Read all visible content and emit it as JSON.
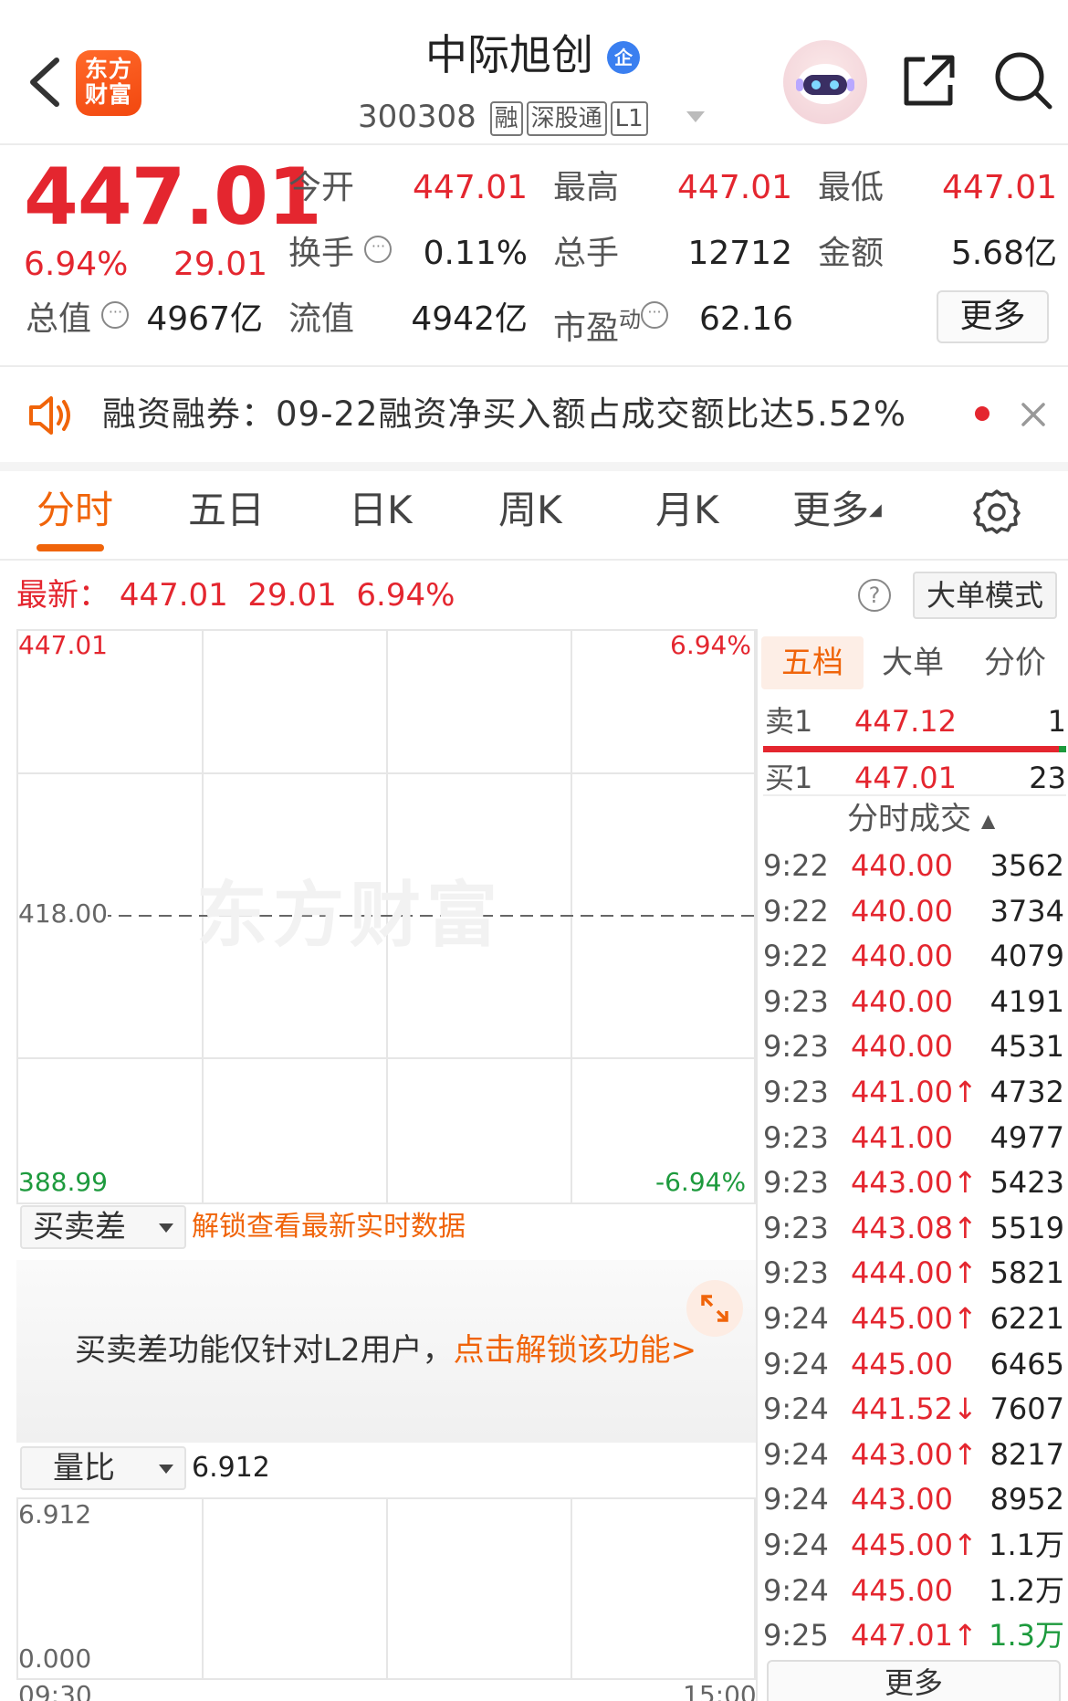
{
  "header": {
    "logo_line1": "东方",
    "logo_line2": "财富",
    "stock_name": "中际旭创",
    "name_badge": "企",
    "stock_code": "300308",
    "tags": [
      "融",
      "深股通",
      "L1"
    ]
  },
  "quote": {
    "price": "447.01",
    "change_pct": "6.94%",
    "change_amt": "29.01",
    "fields": [
      {
        "label": "今开",
        "value": "447.01",
        "color": "red"
      },
      {
        "label": "最高",
        "value": "447.01",
        "color": "red"
      },
      {
        "label": "最低",
        "value": "447.01",
        "color": "red"
      },
      {
        "label": "换手",
        "value": "0.11%",
        "color": "black"
      },
      {
        "label": "总手",
        "value": "12712",
        "color": "black"
      },
      {
        "label": "金额",
        "value": "5.68亿",
        "color": "black"
      },
      {
        "label": "总值",
        "value": "4967亿",
        "color": "black"
      },
      {
        "label": "流值",
        "value": "4942亿",
        "color": "black"
      },
      {
        "label": "市盈",
        "sup": "动",
        "value": "62.16",
        "color": "black"
      }
    ],
    "more_label": "更多",
    "info_icon": "···"
  },
  "notice": {
    "text": "融资融券：09-22融资净买入额占成交额比达5.52%"
  },
  "tabs": [
    "分时",
    "五日",
    "日K",
    "周K",
    "月K",
    "更多"
  ],
  "latest": {
    "label": "最新：",
    "price": "447.01",
    "change": "29.01",
    "pct": "6.94%",
    "help": "?",
    "mode_button": "大单模式"
  },
  "chart": {
    "y_top": "447.01",
    "y_mid": "418.00",
    "y_bottom": "388.99",
    "pct_top": "6.94%",
    "pct_bottom": "-6.94%",
    "watermark": "东方财富"
  },
  "order_book": {
    "tabs": [
      "五档",
      "大单",
      "分价"
    ],
    "sell1": {
      "label": "卖1",
      "price": "447.12",
      "vol": "1"
    },
    "buy1": {
      "label": "买1",
      "price": "447.01",
      "vol": "23"
    },
    "ticks_header": "分时成交",
    "ticks": [
      {
        "time": "9:22",
        "price": "440.00",
        "vol": "3562",
        "price_color": "#e4262f",
        "vol_color": "#222"
      },
      {
        "time": "9:22",
        "price": "440.00",
        "vol": "3734",
        "price_color": "#e4262f",
        "vol_color": "#222"
      },
      {
        "time": "9:22",
        "price": "440.00",
        "vol": "4079",
        "price_color": "#e4262f",
        "vol_color": "#222"
      },
      {
        "time": "9:23",
        "price": "440.00",
        "vol": "4191",
        "price_color": "#e4262f",
        "vol_color": "#222"
      },
      {
        "time": "9:23",
        "price": "440.00",
        "vol": "4531",
        "price_color": "#e4262f",
        "vol_color": "#222"
      },
      {
        "time": "9:23",
        "price": "441.00↑",
        "vol": "4732",
        "price_color": "#e4262f",
        "vol_color": "#222"
      },
      {
        "time": "9:23",
        "price": "441.00",
        "vol": "4977",
        "price_color": "#e4262f",
        "vol_color": "#222"
      },
      {
        "time": "9:23",
        "price": "443.00↑",
        "vol": "5423",
        "price_color": "#e4262f",
        "vol_color": "#222"
      },
      {
        "time": "9:23",
        "price": "443.08↑",
        "vol": "5519",
        "price_color": "#e4262f",
        "vol_color": "#222"
      },
      {
        "time": "9:23",
        "price": "444.00↑",
        "vol": "5821",
        "price_color": "#e4262f",
        "vol_color": "#222"
      },
      {
        "time": "9:24",
        "price": "445.00↑",
        "vol": "6221",
        "price_color": "#e4262f",
        "vol_color": "#222"
      },
      {
        "time": "9:24",
        "price": "445.00",
        "vol": "6465",
        "price_color": "#e4262f",
        "vol_color": "#222"
      },
      {
        "time": "9:24",
        "price": "441.52↓",
        "vol": "7607",
        "price_color": "#e4262f",
        "vol_color": "#222"
      },
      {
        "time": "9:24",
        "price": "443.00↑",
        "vol": "8217",
        "price_color": "#e4262f",
        "vol_color": "#222"
      },
      {
        "time": "9:24",
        "price": "443.00",
        "vol": "8952",
        "price_color": "#e4262f",
        "vol_color": "#222"
      },
      {
        "time": "9:24",
        "price": "445.00↑",
        "vol": "1.1万",
        "price_color": "#e4262f",
        "vol_color": "#222"
      },
      {
        "time": "9:24",
        "price": "445.00",
        "vol": "1.2万",
        "price_color": "#e4262f",
        "vol_color": "#222"
      },
      {
        "time": "9:25",
        "price": "447.01↑",
        "vol": "1.3万",
        "price_color": "#e4262f",
        "vol_color": "#1d9a3d"
      }
    ],
    "more_label": "更多"
  },
  "diff_panel": {
    "select_label": "买卖差",
    "unlock_hint": "解锁查看最新实时数据",
    "lock_text": "买卖差功能仅针对L2用户，",
    "lock_link": "点击解锁该功能>"
  },
  "volume_ratio": {
    "select_label": "量比",
    "value": "6.912",
    "y_top": "6.912",
    "y_bottom": "0.000",
    "x_start": "09:30",
    "x_end": "15:00"
  }
}
